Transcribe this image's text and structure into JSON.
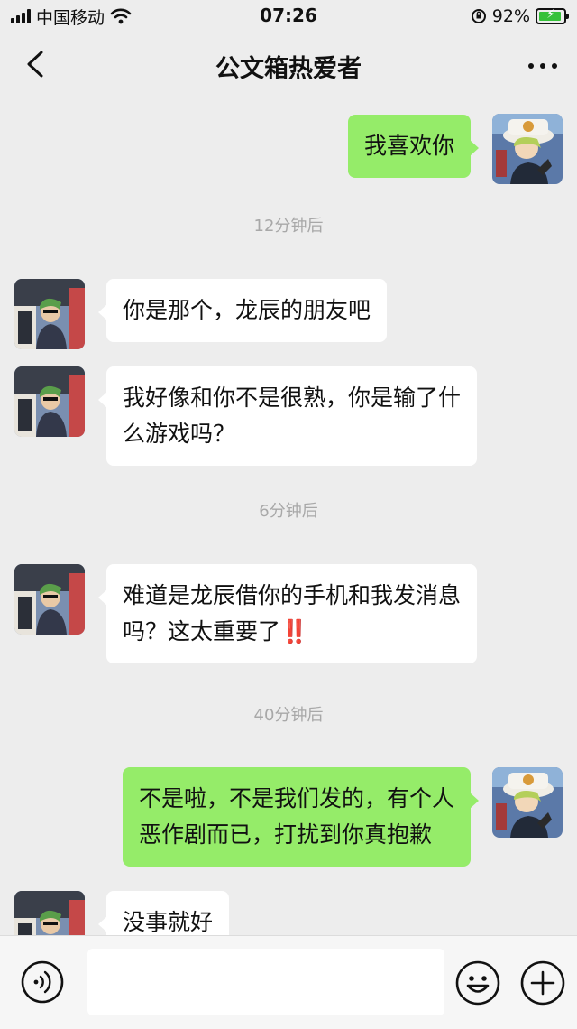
{
  "status_bar": {
    "carrier": "中国移动",
    "time": "07:26",
    "battery": "92%",
    "battery_level": 0.92
  },
  "nav": {
    "title": "公文箱热爱者"
  },
  "messages": {
    "m1": "我喜欢你",
    "t1": "12分钟后",
    "m2": "你是那个，龙辰的朋友吧",
    "m3_line1": "我好像和你不是很熟，你是输了什",
    "m3_line2": "么游戏吗？",
    "t2": "6分钟后",
    "m4_line1": "难道是龙辰借你的手机和我发消息",
    "m4_line2": "吗？这太重要了",
    "m4_emoji": "‼️",
    "t3": "40分钟后",
    "m5_line1": "不是啦，不是我们发的，有个人",
    "m5_line2": "恶作剧而已，打扰到你真抱歉",
    "m6": "没事就好"
  },
  "colors": {
    "background": "#ededed",
    "outgoing_bubble": "#95ec69",
    "incoming_bubble": "#ffffff",
    "timestamp": "#a8a8a8"
  }
}
